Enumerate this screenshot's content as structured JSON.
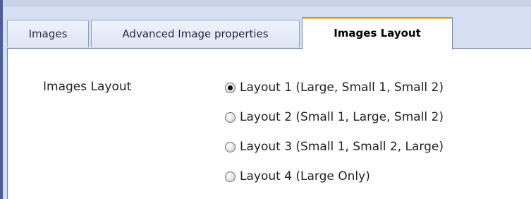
{
  "tabs": [
    {
      "label": "Images",
      "active": false
    },
    {
      "label": "Advanced Image properties",
      "active": false
    },
    {
      "label": "Images Layout",
      "active": true
    }
  ],
  "field": {
    "label": "Images Layout",
    "options": [
      {
        "label": "Layout 1 (Large, Small 1, Small 2)",
        "selected": true
      },
      {
        "label": "Layout 2 (Small 1, Large, Small 2)",
        "selected": false
      },
      {
        "label": "Layout 3 (Small 1, Small 2, Large)",
        "selected": false
      },
      {
        "label": "Layout 4 (Large Only)",
        "selected": false
      }
    ]
  }
}
